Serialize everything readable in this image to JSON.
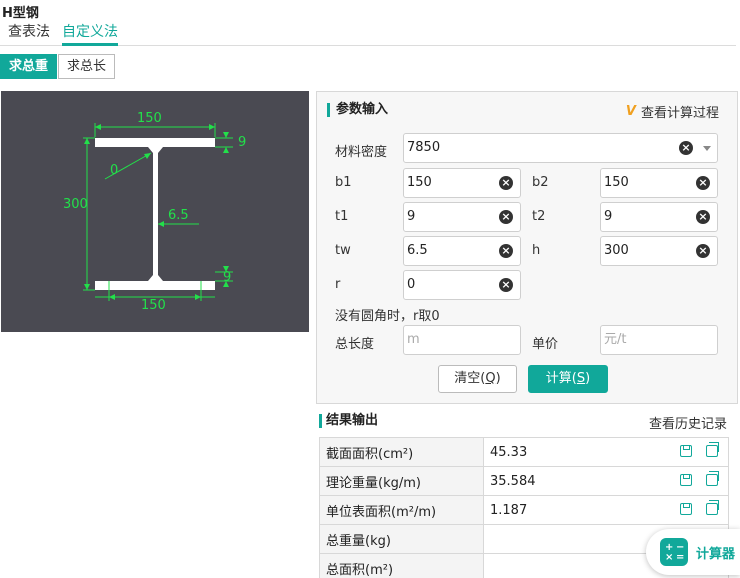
{
  "page": {
    "title": "H型钢"
  },
  "tabs": [
    {
      "label": "查表法",
      "active": false
    },
    {
      "label": "自定义法",
      "active": true
    }
  ],
  "modes": {
    "weight": "求总重",
    "length": "求总长"
  },
  "diagram": {
    "top_width": "150",
    "top_thickness": "9",
    "height": "300",
    "radius": "0",
    "web": "6.5",
    "bottom_thickness": "9",
    "bottom_width": "150"
  },
  "params": {
    "title": "参数输入",
    "vip_badge": "V",
    "process_link": "查看计算过程",
    "density_label": "材料密度",
    "density_value": "7850",
    "b1_label": "b1",
    "b1_value": "150",
    "b2_label": "b2",
    "b2_value": "150",
    "t1_label": "t1",
    "t1_value": "9",
    "t2_label": "t2",
    "t2_value": "9",
    "tw_label": "tw",
    "tw_value": "6.5",
    "h_label": "h",
    "h_value": "300",
    "r_label": "r",
    "r_value": "0",
    "note": "没有圆角时，r取0",
    "length_label": "总长度",
    "length_placeholder": "m",
    "price_label": "单价",
    "price_placeholder": "元/t",
    "clear_label": "清空(",
    "clear_key": "Q",
    "clear_end": ")",
    "calc_label": "计算(",
    "calc_key": "S",
    "calc_end": ")"
  },
  "results": {
    "title": "结果输出",
    "history": "查看历史记录",
    "rows": [
      {
        "label": "截面面积(cm²)",
        "value": "45.33"
      },
      {
        "label": "理论重量(kg/m)",
        "value": "35.584"
      },
      {
        "label": "单位表面积(m²/m)",
        "value": "1.187"
      },
      {
        "label": "总重量(kg)",
        "value": ""
      },
      {
        "label": "总面积(m²)",
        "value": ""
      }
    ]
  },
  "fab": {
    "label": "计算器"
  },
  "colors": {
    "accent": "#11a89a",
    "diagram_bg": "#4a4a52",
    "dimension": "#22e04a"
  }
}
